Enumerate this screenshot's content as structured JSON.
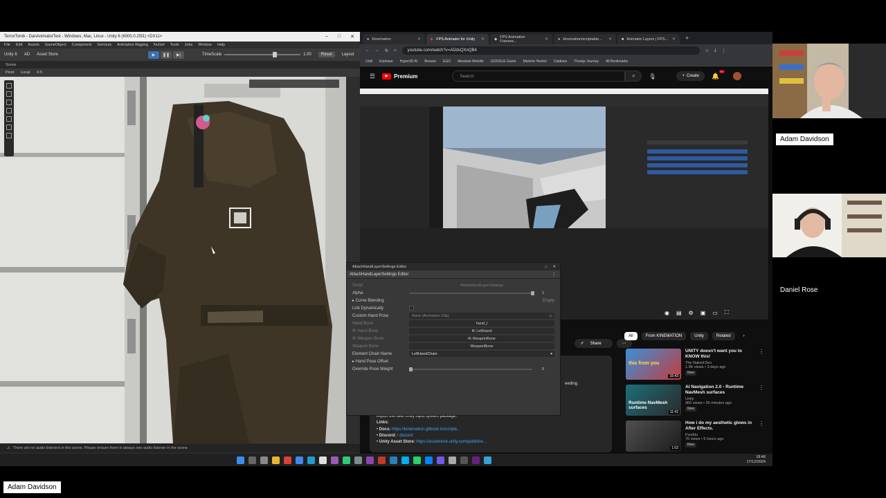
{
  "participants": {
    "main_presenter_label": "Adam Davidson",
    "tiles": [
      {
        "name": "Adam Davidson",
        "style": "boxed"
      },
      {
        "name": "Daniel Rose",
        "style": "plain"
      }
    ]
  },
  "unity": {
    "window_title": "TerrorTomb - DanAnimatorTest - Windows, Mac, Linux - Unity 6 (6000.0.25f1) <DX11>",
    "menu": [
      "File",
      "Edit",
      "Assets",
      "GameObject",
      "Component",
      "Services",
      "Animation Rigging",
      "NuGet",
      "Tools",
      "Jobs",
      "Window",
      "Help"
    ],
    "toolbar": {
      "unity_label": "Unity 6",
      "account": "AD",
      "asset_store": "Asset Store",
      "timescale_label": "TimeScale",
      "timescale_value": "1.00",
      "reset": "Reset",
      "layout": "Layout"
    },
    "scene_tab": "Scene",
    "scene_tools": {
      "pivot": "Pivot",
      "local": "Local",
      "snap": "0.5"
    },
    "status": "There are no audio listeners in the scene. Please ensure there is always one audio listener in the scene"
  },
  "browser": {
    "tabs": [
      {
        "label": "Kinemation",
        "active": false
      },
      {
        "label": "FPS Animator for Unity",
        "active": true
      },
      {
        "label": "FPS Animation Framew...",
        "active": false
      },
      {
        "label": "kinemation/scriptable...",
        "active": false
      },
      {
        "label": "Animator Layers | FPS...",
        "active": false
      }
    ],
    "url": "youtube.com/watch?v=ADdsQXnQB4",
    "bookmarks": [
      "Unifi",
      "Enphase",
      "Hyper3D AI",
      "Browse",
      "EGO",
      "Absolute Worldle",
      "GOOGLE Game",
      "Maxime Heckel",
      "Citations",
      "Threejs Journey",
      "All Bookmarks"
    ],
    "yt": {
      "logo": "Premium",
      "search_placeholder": "Search",
      "create": "Create",
      "notif_badge": "9+",
      "chips": [
        {
          "label": "All",
          "active": true
        },
        {
          "label": "From KINEMATION",
          "active": false
        },
        {
          "label": "Unity",
          "active": false
        },
        {
          "label": "Related",
          "active": false
        }
      ],
      "share": "Share",
      "recommendations": [
        {
          "title": "UNITY doesn't want you to KNOW this!",
          "channel": "The Naked Dev",
          "stats": "1.9K views • 3 days ago",
          "badge": "New",
          "duration": "16:43",
          "thumb_text": "this from you"
        },
        {
          "title": "AI Navigation 2.0 - Runtime NavMesh surfaces",
          "channel": "Unity",
          "stats": "366 views • 26 minutes ago",
          "badge": "New",
          "duration": "11:42",
          "thumb_text": "Runtime NavMesh surfaces"
        },
        {
          "title": "How i do my aesthetic glows in After Effects.",
          "channel": "Furykiu",
          "stats": "76 views • 5 hours ago",
          "badge": "New",
          "duration": "1:03",
          "thumb_text": ""
        }
      ],
      "description": {
        "feeding": "eeding.",
        "import_note": "import the new Unity input system package.",
        "links_header": "Links:",
        "docs_label": "Docs:",
        "docs_url": "https://kinemation.gitbook.io/scripta...",
        "discord_label": "Discord:",
        "discord_text": "/ discord",
        "store_label": "Unity Asset Store:",
        "store_url": "https://assetstore.unity.com/publishe..."
      }
    }
  },
  "popup": {
    "title": "AttachHandLayerSettings Editor",
    "tab": "AttachHandLayerSettings Editor",
    "rows": {
      "script_label": "Script",
      "script_value": "AttachHandLayerSettings",
      "alpha_label": "Alpha",
      "alpha_value": "1",
      "curve_blending": "Curve Blending",
      "curve_empty": "Empty",
      "link_dynamically": "Link Dynamically",
      "custom_hand_pose": "Custom Hand Pose",
      "custom_hand_pose_value": "None (Animation Clip)",
      "hand_bone_label": "Hand Bone",
      "hand_bone_value": "hand_l",
      "ik_hand_bone_label": "IK Hand Bone",
      "ik_hand_bone_value": "IK LeftHand",
      "ik_weapon_bone_label": "IK Weapon Bone",
      "ik_weapon_bone_value": "IK WeaponBone",
      "weapon_bone_label": "Weapon Bone",
      "weapon_bone_value": "WeaponBone",
      "element_chain_name": "Element Chain Name",
      "element_chain_value": "LeftHandChain",
      "hand_pose_offset": "Hand Pose Offset",
      "override_pose_weight": "Override Pose Weight",
      "override_pose_value": "0"
    }
  },
  "taskbar": {
    "time": "18:46",
    "date": "17/12/2024"
  }
}
